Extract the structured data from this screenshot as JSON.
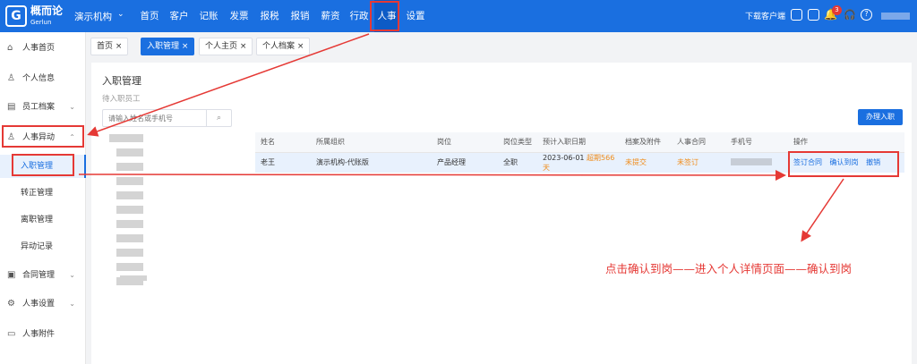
{
  "topbar": {
    "logo_glyph": "G",
    "brand": "概而论",
    "brand_en": "Gerlun",
    "org": "演示机构",
    "nav": [
      "首页",
      "客户",
      "记账",
      "发票",
      "报税",
      "报销",
      "薪资",
      "行政",
      "人事",
      "设置"
    ],
    "download": "下载客户端",
    "badge": "3"
  },
  "sidebar": {
    "items": [
      "人事首页",
      "个人信息",
      "员工档案",
      "人事异动",
      "入职管理",
      "转正管理",
      "离职管理",
      "异动记录",
      "合同管理",
      "人事设置",
      "人事附件"
    ]
  },
  "tabs": [
    "首页",
    "入职管理",
    "个人主页",
    "个人档案"
  ],
  "main": {
    "title": "入职管理",
    "section": "待入职员工",
    "search_placeholder": "请输入姓名或手机号",
    "handle_button": "办理入职",
    "columns": [
      "姓名",
      "所属组织",
      "岗位",
      "岗位类型",
      "预计入职日期",
      "档案及附件",
      "人事合同",
      "手机号",
      "操作"
    ],
    "row": {
      "name": "老王",
      "org": "演示机构-代账版",
      "post": "产品经理",
      "type": "全职",
      "date": "2023-06-01",
      "overdue": "超期566天",
      "archive": "未提交",
      "contract": "未签订",
      "actions": [
        "签订合同",
        "确认到岗",
        "撤销"
      ]
    }
  },
  "annotation": "点击确认到岗——进入个人详情页面——确认到岗",
  "colors": {
    "brand": "#1a6fe0",
    "annotation": "#e53935",
    "warning": "#f08c1a"
  }
}
